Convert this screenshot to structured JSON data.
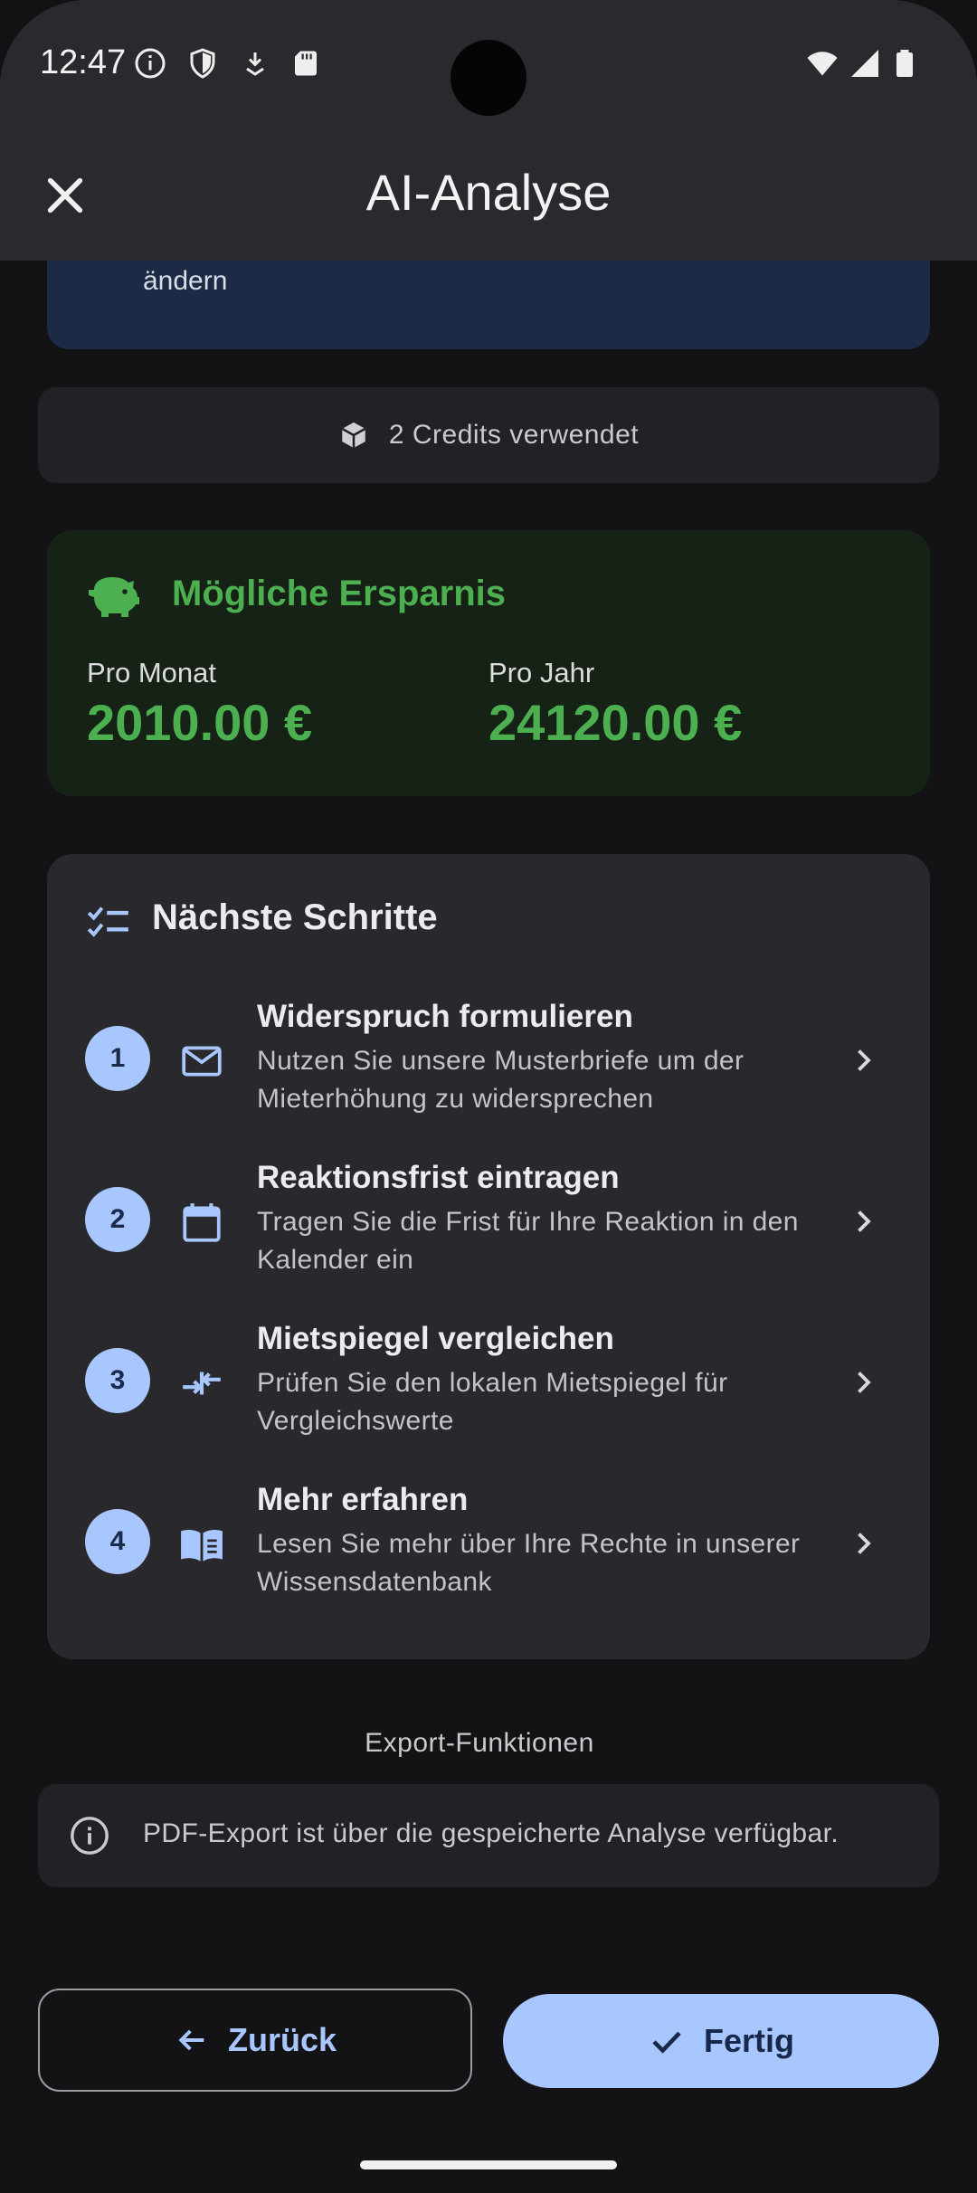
{
  "status_bar": {
    "time": "12:47"
  },
  "app_bar": {
    "title": "AI-Analyse"
  },
  "banner": {
    "text": "ändern"
  },
  "credits": {
    "label": "2 Credits verwendet"
  },
  "savings": {
    "title": "Mögliche Ersparnis",
    "per_month_label": "Pro Monat",
    "per_month_value": "2010.00 €",
    "per_year_label": "Pro Jahr",
    "per_year_value": "24120.00 €",
    "accent_color": "#4caf50"
  },
  "next_steps": {
    "title": "Nächste Schritte",
    "items": [
      {
        "number": "1",
        "icon": "mail-icon",
        "title": "Widerspruch formulieren",
        "description": "Nutzen Sie unsere Musterbriefe um der Mieterhöhung zu widersprechen"
      },
      {
        "number": "2",
        "icon": "calendar-icon",
        "title": "Reaktionsfrist eintragen",
        "description": "Tragen Sie die Frist für Ihre Reaktion in den Kalender ein"
      },
      {
        "number": "3",
        "icon": "compare-arrows-icon",
        "title": "Mietspiegel vergleichen",
        "description": "Prüfen Sie den lokalen Mietspiegel für Vergleichswerte"
      },
      {
        "number": "4",
        "icon": "book-icon",
        "title": "Mehr erfahren",
        "description": "Lesen Sie mehr über Ihre Rechte in unserer Wissensdatenbank"
      }
    ]
  },
  "export": {
    "heading": "Export-Funktionen",
    "info": "PDF-Export ist über die gespeicherte Analyse verfügbar."
  },
  "actions": {
    "back_label": "Zurück",
    "done_label": "Fertig",
    "accent_color": "#a9c7ff"
  }
}
